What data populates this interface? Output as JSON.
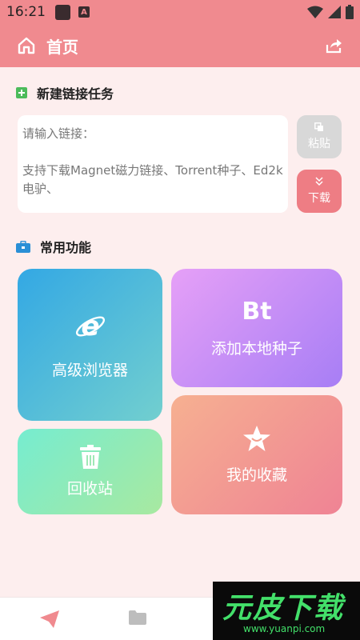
{
  "status_bar": {
    "time": "16:21",
    "notification_badge": "A"
  },
  "app_bar": {
    "title": "首页",
    "home_icon": "home-icon",
    "share_icon": "share-icon"
  },
  "new_task": {
    "heading": "新建链接任务",
    "placeholder": "请输入链接：",
    "hint": "支持下载Magnet磁力链接、Torrent种子、Ed2k电驴、",
    "paste_label": "粘贴",
    "download_label": "下载"
  },
  "features": {
    "heading": "常用功能",
    "browser_label": "高级浏览器",
    "torrent_label": "添加本地种子",
    "torrent_icon_text": "Bt",
    "recycle_label": "回收站",
    "favorites_label": "我的收藏"
  },
  "colors": {
    "accent": "#f08a8f",
    "background": "#fdeeee"
  },
  "bottom_nav": {
    "items": [
      "send-icon",
      "folder-icon"
    ]
  },
  "watermark": {
    "brand": "元皮下载",
    "url": "www.yuanpi.com"
  }
}
